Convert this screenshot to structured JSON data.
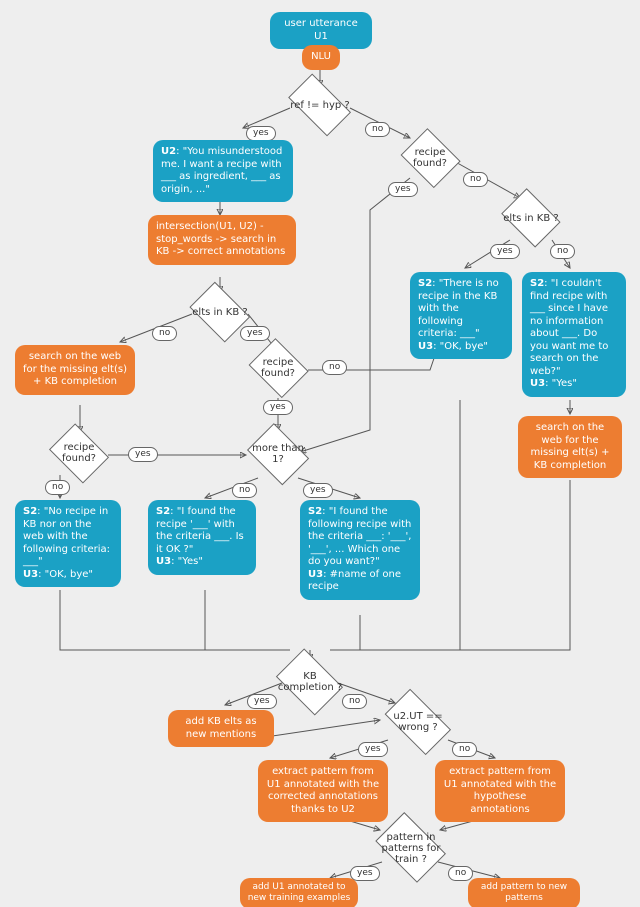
{
  "chart_data": {
    "type": "flowchart",
    "title": "",
    "nodes": [
      {
        "id": "u1",
        "kind": "start",
        "label": "user utterance U1"
      },
      {
        "id": "nlu",
        "kind": "process",
        "label": "NLU"
      },
      {
        "id": "d_ref",
        "kind": "decision",
        "label": "ref != hyp ?"
      },
      {
        "id": "u2",
        "kind": "io",
        "label": "U2: \"You misunderstood me. I want a recipe with ___ as ingredient, ___ as origin, ...\""
      },
      {
        "id": "inter",
        "kind": "process",
        "label": "intersection(U1, U2) - stop_words -> search in KB -> correct annotations"
      },
      {
        "id": "d_elts1",
        "kind": "decision",
        "label": "elts in KB ?"
      },
      {
        "id": "webL",
        "kind": "process",
        "label": "search on the web for the missing elt(s) + KB completion"
      },
      {
        "id": "d_rfL",
        "kind": "decision",
        "label": "recipe found?"
      },
      {
        "id": "s2web",
        "kind": "io",
        "label": "S2: \"No recipe in KB nor on the web with the following criteria: ___\"  U3: \"OK, bye\""
      },
      {
        "id": "d_rf2",
        "kind": "decision",
        "label": "recipe found?"
      },
      {
        "id": "d_more",
        "kind": "decision",
        "label": "more than 1?"
      },
      {
        "id": "s2one",
        "kind": "io",
        "label": "S2: \"I found the recipe '___' with the criteria ___. Is it OK ?\"  U3: \"Yes\""
      },
      {
        "id": "s2many",
        "kind": "io",
        "label": "S2: \"I found the following recipe with the criteria ___: '___', '___', ... Which one do you want?\"  U3: #name of one recipe"
      },
      {
        "id": "d_rfR",
        "kind": "decision",
        "label": "recipe found?"
      },
      {
        "id": "d_elts2",
        "kind": "decision",
        "label": "elts in KB ?"
      },
      {
        "id": "s2nokb",
        "kind": "io",
        "label": "S2: \"There is no recipe in the KB with the following criteria: ___\"  U3: \"OK, bye\""
      },
      {
        "id": "s2noinfo",
        "kind": "io",
        "label": "S2: \"I couldn't find recipe with ___ since I have no information about ___. Do you want me to search on the web?\"  U3: \"Yes\""
      },
      {
        "id": "webR",
        "kind": "process",
        "label": "search on the web for the missing elt(s) + KB completion"
      },
      {
        "id": "d_kbcomp",
        "kind": "decision",
        "label": "KB completion ?"
      },
      {
        "id": "addkb",
        "kind": "process",
        "label": "add KB elts as new mentions"
      },
      {
        "id": "d_u2ut",
        "kind": "decision",
        "label": "u2.UT == wrong ?"
      },
      {
        "id": "patC",
        "kind": "process",
        "label": "extract pattern from U1 annotated with the corrected annotations thanks to U2"
      },
      {
        "id": "patH",
        "kind": "process",
        "label": "extract pattern from U1 annotated with the hypothese annotations"
      },
      {
        "id": "d_patin",
        "kind": "decision",
        "label": "pattern in patterns for train ?"
      },
      {
        "id": "addU1",
        "kind": "process",
        "label": "add U1 annotated to new training examples"
      },
      {
        "id": "addPat",
        "kind": "process",
        "label": "add pattern to new patterns"
      }
    ],
    "edges": [
      {
        "from": "u1",
        "to": "nlu",
        "label": ""
      },
      {
        "from": "nlu",
        "to": "d_ref",
        "label": ""
      },
      {
        "from": "d_ref",
        "to": "u2",
        "label": "yes"
      },
      {
        "from": "d_ref",
        "to": "d_rfR",
        "label": "no"
      },
      {
        "from": "u2",
        "to": "inter",
        "label": ""
      },
      {
        "from": "inter",
        "to": "d_elts1",
        "label": ""
      },
      {
        "from": "d_elts1",
        "to": "webL",
        "label": "no"
      },
      {
        "from": "d_elts1",
        "to": "d_rf2",
        "label": "yes"
      },
      {
        "from": "webL",
        "to": "d_rfL",
        "label": ""
      },
      {
        "from": "d_rfL",
        "to": "s2web",
        "label": "no"
      },
      {
        "from": "d_rfL",
        "to": "d_more",
        "label": "yes"
      },
      {
        "from": "d_rf2",
        "to": "d_more",
        "label": "yes"
      },
      {
        "from": "d_rf2",
        "to": "s2nokb",
        "label": "no"
      },
      {
        "from": "d_more",
        "to": "s2one",
        "label": "no"
      },
      {
        "from": "d_more",
        "to": "s2many",
        "label": "yes"
      },
      {
        "from": "d_rfR",
        "to": "d_more",
        "label": "yes"
      },
      {
        "from": "d_rfR",
        "to": "d_elts2",
        "label": "no"
      },
      {
        "from": "d_elts2",
        "to": "s2nokb",
        "label": "yes"
      },
      {
        "from": "d_elts2",
        "to": "s2noinfo",
        "label": "no"
      },
      {
        "from": "s2noinfo",
        "to": "webR",
        "label": ""
      },
      {
        "from": "s2web",
        "to": "d_kbcomp",
        "label": ""
      },
      {
        "from": "s2one",
        "to": "d_kbcomp",
        "label": ""
      },
      {
        "from": "s2many",
        "to": "d_kbcomp",
        "label": ""
      },
      {
        "from": "s2nokb",
        "to": "d_kbcomp",
        "label": ""
      },
      {
        "from": "webR",
        "to": "d_kbcomp",
        "label": ""
      },
      {
        "from": "d_kbcomp",
        "to": "addkb",
        "label": "yes"
      },
      {
        "from": "d_kbcomp",
        "to": "d_u2ut",
        "label": "no"
      },
      {
        "from": "addkb",
        "to": "d_u2ut",
        "label": ""
      },
      {
        "from": "d_u2ut",
        "to": "patC",
        "label": "yes"
      },
      {
        "from": "d_u2ut",
        "to": "patH",
        "label": "no"
      },
      {
        "from": "patC",
        "to": "d_patin",
        "label": ""
      },
      {
        "from": "patH",
        "to": "d_patin",
        "label": ""
      },
      {
        "from": "d_patin",
        "to": "addU1",
        "label": "yes"
      },
      {
        "from": "d_patin",
        "to": "addPat",
        "label": "no"
      }
    ]
  },
  "labels": {
    "yes": "yes",
    "no": "no"
  },
  "nodes": {
    "u1": "user utterance U1",
    "nlu": "NLU",
    "d_ref": "ref != hyp ?",
    "u2_s": "U2",
    "u2_t": ": \"You misunderstood me. I want a recipe with ___ as ingredient, ___ as origin, ...\"",
    "inter": "intersection(U1, U2) - stop_words -> search in KB -> correct annotations",
    "d_elts": "elts in KB ?",
    "webL": "search on the web for the missing elt(s) + KB completion",
    "d_rf": "recipe found?",
    "s2web_s": "S2",
    "s2web_t": ": \"No recipe in KB nor on the web with the following criteria: ___\"",
    "u3bye_s": "U3",
    "u3bye_t": ": \"OK, bye\"",
    "d_more": "more than 1?",
    "s2one_s": "S2",
    "s2one_t": ": \"I found the recipe '___' with the criteria ___. Is it OK ?\"",
    "u3yes_s": "U3",
    "u3yes_t": ": \"Yes\"",
    "s2many_s": "S2",
    "s2many_t": ": \"I found the following recipe with the criteria ___: '___', '___', ... Which one do you want?\"",
    "u3name_s": "U3",
    "u3name_t": ": #name of one recipe",
    "s2nokb_s": "S2",
    "s2nokb_t": ": \"There is no recipe in the KB with the following criteria: ___\"",
    "s2noinfo_s": "S2",
    "s2noinfo_t": ": \"I couldn't find recipe with ___ since I have no information about ___. Do you want me to search on the web?\"",
    "webR": "search on the web for the missing elt(s) + KB completion",
    "d_kbcomp": "KB completion ?",
    "addkb": "add KB elts as new mentions",
    "d_u2ut": "u2.UT == wrong ?",
    "patC": "extract pattern from U1 annotated with the corrected annotations thanks to U2",
    "patH": "extract pattern from U1 annotated with the hypothese annotations",
    "d_patin": "pattern in patterns for train ?",
    "addU1": "add U1 annotated to new training examples",
    "addPat": "add pattern to new patterns"
  }
}
